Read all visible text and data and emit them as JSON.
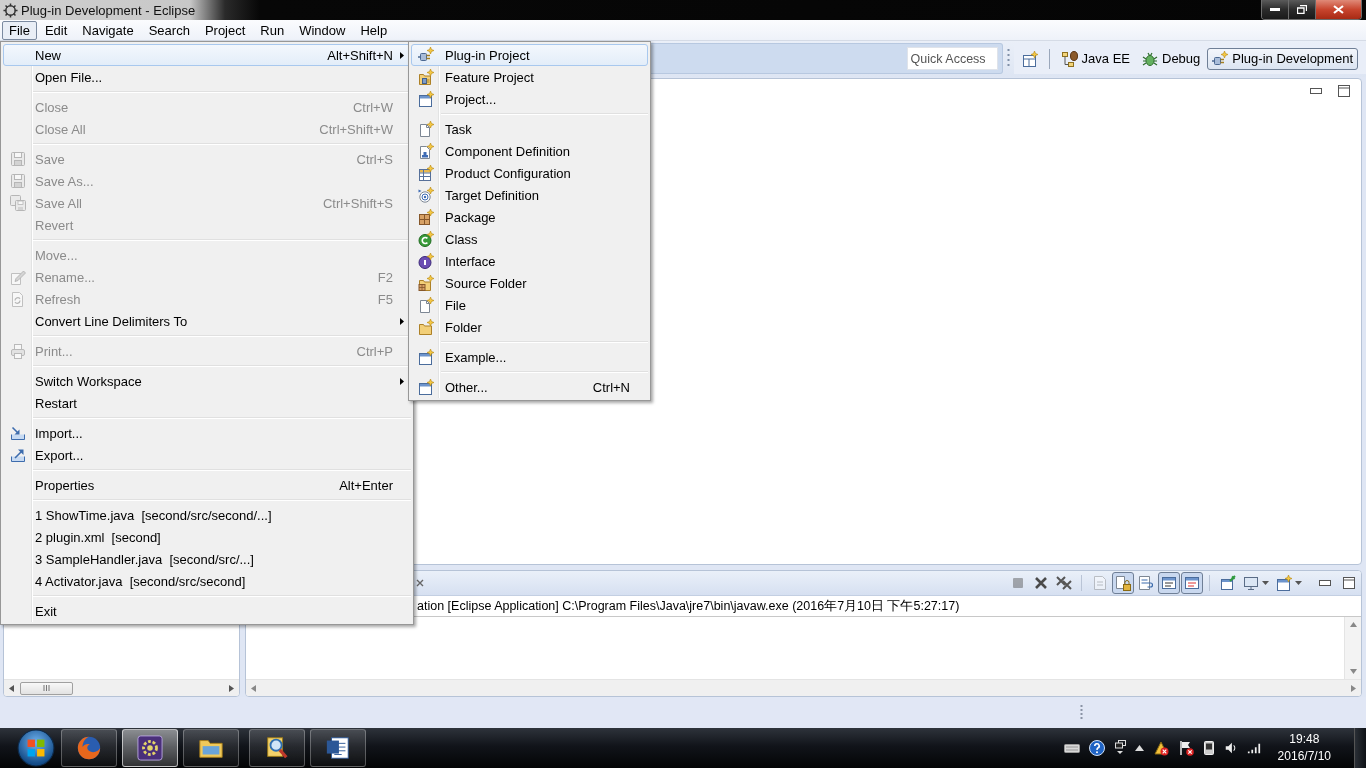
{
  "window": {
    "title": "Plug-in Development - Eclipse"
  },
  "menu_bar": [
    {
      "label": "File",
      "selected": true
    },
    {
      "label": "Edit",
      "selected": false
    },
    {
      "label": "Navigate",
      "selected": false
    },
    {
      "label": "Search",
      "selected": false
    },
    {
      "label": "Project",
      "selected": false
    },
    {
      "label": "Run",
      "selected": false
    },
    {
      "label": "Window",
      "selected": false
    },
    {
      "label": "Help",
      "selected": false
    }
  ],
  "toolbar": {
    "quick_access": {
      "placeholder": "Quick Access"
    },
    "perspectives": [
      {
        "label": "Java EE",
        "selected": false
      },
      {
        "label": "Debug",
        "selected": false
      },
      {
        "label": "Plug-in Development",
        "selected": true
      }
    ]
  },
  "file_menu": {
    "items": [
      {
        "kind": "item",
        "label": "New",
        "shortcut": "Alt+Shift+N",
        "submenu": true,
        "disabled": false,
        "selected": true
      },
      {
        "kind": "item",
        "label": "Open File...",
        "submenu": false,
        "disabled": false,
        "selected": false
      },
      {
        "kind": "separator"
      },
      {
        "kind": "item",
        "label": "Close",
        "shortcut": "Ctrl+W",
        "submenu": false,
        "disabled": true,
        "selected": false
      },
      {
        "kind": "item",
        "label": "Close All",
        "shortcut": "Ctrl+Shift+W",
        "submenu": false,
        "disabled": true,
        "selected": false
      },
      {
        "kind": "separator"
      },
      {
        "kind": "item",
        "label": "Save",
        "shortcut": "Ctrl+S",
        "submenu": false,
        "disabled": true,
        "selected": false
      },
      {
        "kind": "item",
        "label": "Save As...",
        "submenu": false,
        "disabled": true,
        "selected": false
      },
      {
        "kind": "item",
        "label": "Save All",
        "shortcut": "Ctrl+Shift+S",
        "submenu": false,
        "disabled": true,
        "selected": false
      },
      {
        "kind": "item",
        "label": "Revert",
        "submenu": false,
        "disabled": true,
        "selected": false
      },
      {
        "kind": "separator"
      },
      {
        "kind": "item",
        "label": "Move...",
        "submenu": false,
        "disabled": true,
        "selected": false
      },
      {
        "kind": "item",
        "label": "Rename...",
        "shortcut": "F2",
        "submenu": false,
        "disabled": true,
        "selected": false
      },
      {
        "kind": "item",
        "label": "Refresh",
        "shortcut": "F5",
        "submenu": false,
        "disabled": true,
        "selected": false
      },
      {
        "kind": "item",
        "label": "Convert Line Delimiters To",
        "submenu": true,
        "disabled": false,
        "selected": false
      },
      {
        "kind": "separator"
      },
      {
        "kind": "item",
        "label": "Print...",
        "shortcut": "Ctrl+P",
        "submenu": false,
        "disabled": true,
        "selected": false
      },
      {
        "kind": "separator"
      },
      {
        "kind": "item",
        "label": "Switch Workspace",
        "submenu": true,
        "disabled": false,
        "selected": false
      },
      {
        "kind": "item",
        "label": "Restart",
        "submenu": false,
        "disabled": false,
        "selected": false
      },
      {
        "kind": "separator"
      },
      {
        "kind": "item",
        "label": "Import...",
        "submenu": false,
        "disabled": false,
        "selected": false
      },
      {
        "kind": "item",
        "label": "Export...",
        "submenu": false,
        "disabled": false,
        "selected": false
      },
      {
        "kind": "separator"
      },
      {
        "kind": "item",
        "label": "Properties",
        "shortcut": "Alt+Enter",
        "submenu": false,
        "disabled": false,
        "selected": false
      },
      {
        "kind": "separator"
      },
      {
        "kind": "item",
        "label": "1 ShowTime.java  [second/src/second/...]",
        "submenu": false,
        "disabled": false,
        "selected": false
      },
      {
        "kind": "item",
        "label": "2 plugin.xml  [second]",
        "submenu": false,
        "disabled": false,
        "selected": false
      },
      {
        "kind": "item",
        "label": "3 SampleHandler.java  [second/src/...]",
        "submenu": false,
        "disabled": false,
        "selected": false
      },
      {
        "kind": "item",
        "label": "4 Activator.java  [second/src/second]",
        "submenu": false,
        "disabled": false,
        "selected": false
      },
      {
        "kind": "separator"
      },
      {
        "kind": "item",
        "label": "Exit",
        "submenu": false,
        "disabled": false,
        "selected": false
      }
    ]
  },
  "new_submenu": {
    "items": [
      {
        "kind": "item",
        "label": "Plug-in Project",
        "selected": true
      },
      {
        "kind": "item",
        "label": "Feature Project",
        "selected": false
      },
      {
        "kind": "item",
        "label": "Project...",
        "selected": false
      },
      {
        "kind": "separator"
      },
      {
        "kind": "item",
        "label": "Task",
        "selected": false
      },
      {
        "kind": "item",
        "label": "Component Definition",
        "selected": false
      },
      {
        "kind": "item",
        "label": "Product Configuration",
        "selected": false
      },
      {
        "kind": "item",
        "label": "Target Definition",
        "selected": false
      },
      {
        "kind": "item",
        "label": "Package",
        "selected": false
      },
      {
        "kind": "item",
        "label": "Class",
        "selected": false
      },
      {
        "kind": "item",
        "label": "Interface",
        "selected": false
      },
      {
        "kind": "item",
        "label": "Source Folder",
        "selected": false
      },
      {
        "kind": "item",
        "label": "File",
        "selected": false
      },
      {
        "kind": "item",
        "label": "Folder",
        "selected": false
      },
      {
        "kind": "separator"
      },
      {
        "kind": "item",
        "label": "Example...",
        "selected": false
      },
      {
        "kind": "separator"
      },
      {
        "kind": "item",
        "label": "Other...",
        "shortcut": "Ctrl+N",
        "selected": false
      }
    ]
  },
  "console": {
    "toolbar": [
      {
        "kind": "button",
        "pressed": false,
        "disabled": true
      },
      {
        "kind": "button",
        "pressed": false,
        "disabled": false
      },
      {
        "kind": "button",
        "pressed": false,
        "disabled": false
      },
      {
        "kind": "separator"
      },
      {
        "kind": "button",
        "pressed": false,
        "disabled": true
      },
      {
        "kind": "button",
        "pressed": true,
        "disabled": false
      },
      {
        "kind": "button",
        "pressed": false,
        "disabled": false
      },
      {
        "kind": "button",
        "pressed": true,
        "disabled": false
      },
      {
        "kind": "button",
        "pressed": true,
        "disabled": false
      },
      {
        "kind": "separator"
      },
      {
        "kind": "button",
        "pressed": false,
        "disabled": false
      },
      {
        "kind": "dropdown",
        "pressed": false,
        "disabled": false
      },
      {
        "kind": "dropdown",
        "pressed": false,
        "disabled": false
      }
    ],
    "description": "ation [Eclipse Application] C:\\Program Files\\Java\\jre7\\bin\\javaw.exe (2016年7月10日 下午5:27:17)"
  },
  "taskbar": {
    "apps": [
      {
        "selected": false
      },
      {
        "selected": true
      },
      {
        "selected": false
      },
      {
        "selected": false
      },
      {
        "selected": false
      }
    ],
    "clock": {
      "time": "19:48",
      "date": "2016/7/10"
    }
  }
}
